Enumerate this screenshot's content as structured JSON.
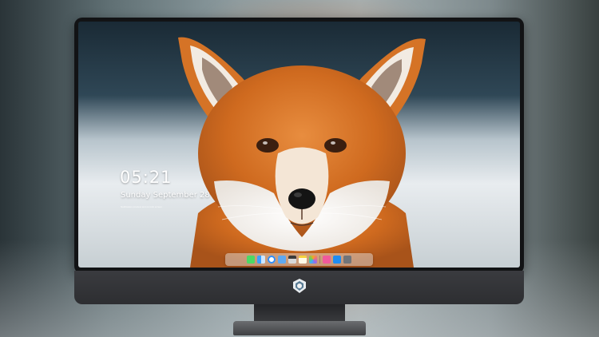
{
  "lockscreen": {
    "time": "05:21",
    "date": "Sunday September 28",
    "notice": "Notification preview text on lock screen"
  },
  "dock": {
    "items": [
      {
        "icon": "messages-icon",
        "color": "#4cd964"
      },
      {
        "icon": "finder-icon",
        "color": "#2f8bf5"
      },
      {
        "icon": "safari-icon",
        "color": "#ffffff"
      },
      {
        "icon": "mail-icon",
        "color": "#5fa8f0"
      },
      {
        "icon": "claquette-icon",
        "color": "#3b3b3b"
      },
      {
        "icon": "notes-icon",
        "color": "#f7d23e"
      },
      {
        "icon": "photos-icon",
        "color": "#e96b8a"
      },
      {
        "icon": "music-icon",
        "color": "#f05a9b"
      },
      {
        "icon": "app-store-icon",
        "color": "#1e8cf0"
      },
      {
        "icon": "camera-icon",
        "color": "#707479"
      }
    ]
  },
  "colors": {
    "bezel": "#121315",
    "chin": "#333437",
    "fox_orange": "#d9772a"
  }
}
